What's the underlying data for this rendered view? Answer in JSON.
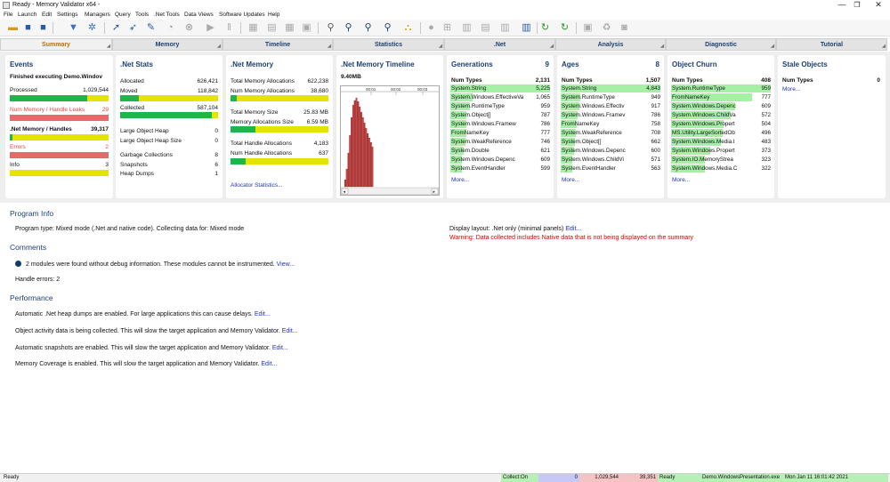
{
  "window": {
    "title": "Ready - Memory Validator x64 -",
    "minimize": "—",
    "maximize": "❐",
    "close": "✕"
  },
  "menu": [
    "File",
    "Launch",
    "Edit",
    "Settings",
    "Managers",
    "Query",
    "Tools",
    ".Net Tools",
    "Data Views",
    "Software Updates",
    "Help"
  ],
  "tabs": [
    "Summary",
    "Memory",
    "Timeline",
    "Statistics",
    ".Net",
    "Analysis",
    "Diagnostic",
    "Tutorial"
  ],
  "events": {
    "title": "Events",
    "status": "Finished executing Demo.Windov",
    "processed_label": "Processed",
    "processed_value": "1,029,544",
    "processed_fraction": 0.78,
    "leaks_label": "Num Memory / Handle Leaks",
    "leaks_value": "29",
    "handles_label": ".Net Memory / Handles",
    "handles_value": "39,317",
    "handles_fraction": 0.03,
    "errors_label": "Errors",
    "errors_value": "2",
    "info_label": "Info",
    "info_value": "3"
  },
  "netstats": {
    "title": ".Net Stats",
    "allocated_label": "Allocated",
    "allocated_value": "626,421",
    "moved_label": "Moved",
    "moved_value": "118,842",
    "moved_fraction": 0.19,
    "collected_label": "Collected",
    "collected_value": "587,104",
    "collected_fraction": 0.94,
    "loh_label": "Large Object Heap",
    "loh_value": "0",
    "lohs_label": "Large Object Heap Size",
    "lohs_value": "0",
    "gc_label": "Garbage Collections",
    "gc_value": "8",
    "snap_label": "Snapshots",
    "snap_value": "6",
    "dumps_label": "Heap Dumps",
    "dumps_value": "1"
  },
  "netmemory": {
    "title": ".Net Memory",
    "total_alloc_label": "Total Memory Allocations",
    "total_alloc_value": "622,238",
    "num_alloc_label": "Num Memory Allocations",
    "num_alloc_value": "38,680",
    "num_alloc_fraction": 0.06,
    "total_size_label": "Total Memory Size",
    "total_size_value": "25.83 MB",
    "alloc_size_label": "Memory Allocations Size",
    "alloc_size_value": "6.59 MB",
    "alloc_size_fraction": 0.25,
    "total_handle_label": "Total Handle Allocations",
    "total_handle_value": "4,183",
    "num_handle_label": "Num Handle Allocations",
    "num_handle_value": "637",
    "num_handle_fraction": 0.15,
    "link": "Allocator Statistics..."
  },
  "timeline": {
    "title": ".Net Memory Timeline",
    "peak": "9.40MB",
    "ticks": [
      "00:01",
      "00:02",
      "00:03"
    ]
  },
  "chart_data": {
    "type": "bar",
    "values": [
      8,
      20,
      38,
      58,
      78,
      92,
      97,
      100,
      96,
      90,
      84,
      78,
      72,
      66,
      60,
      55,
      50,
      45
    ],
    "ylim": [
      0,
      100
    ],
    "xlabel": "",
    "ylabel": ""
  },
  "generations": {
    "title": "Generations",
    "count": "9",
    "header_label": "Num Types",
    "header_value": "2,131",
    "rows": [
      {
        "name": "System.String",
        "value": "5,225",
        "frac": 1.0
      },
      {
        "name": "System.Windows.EffectiveVa",
        "value": "1,065",
        "frac": 0.22
      },
      {
        "name": "System.RuntimeType",
        "value": "959",
        "frac": 0.2
      },
      {
        "name": "System.Object[]",
        "value": "787",
        "frac": 0.16
      },
      {
        "name": "System.Windows.Framew",
        "value": "786",
        "frac": 0.16
      },
      {
        "name": "FromNameKey",
        "value": "777",
        "frac": 0.16
      },
      {
        "name": "System.WeakReference",
        "value": "746",
        "frac": 0.15
      },
      {
        "name": "System.Double",
        "value": "621",
        "frac": 0.13
      },
      {
        "name": "System.Windows.Depenc",
        "value": "609",
        "frac": 0.12
      },
      {
        "name": "System.EventHandler",
        "value": "599",
        "frac": 0.12
      }
    ],
    "more": "More..."
  },
  "ages": {
    "title": "Ages",
    "count": "8",
    "header_label": "Num Types",
    "header_value": "1,507",
    "rows": [
      {
        "name": "System.String",
        "value": "4,843",
        "frac": 1.0
      },
      {
        "name": "System.RuntimeType",
        "value": "949",
        "frac": 0.2
      },
      {
        "name": "System.Windows.Effectiv",
        "value": "917",
        "frac": 0.19
      },
      {
        "name": "System.Windows.Framev",
        "value": "786",
        "frac": 0.17
      },
      {
        "name": "FromNameKey",
        "value": "758",
        "frac": 0.16
      },
      {
        "name": "System.WeakReference",
        "value": "708",
        "frac": 0.15
      },
      {
        "name": "System.Object[]",
        "value": "662",
        "frac": 0.14
      },
      {
        "name": "System.Windows.Depenc",
        "value": "600",
        "frac": 0.13
      },
      {
        "name": "System.Windows.ChildVi",
        "value": "571",
        "frac": 0.12
      },
      {
        "name": "System.EventHandler",
        "value": "563",
        "frac": 0.12
      }
    ],
    "more": "More..."
  },
  "churn": {
    "title": "Object Churn",
    "header_label": "Num Types",
    "header_value": "408",
    "rows": [
      {
        "name": "System.RuntimeType",
        "value": "959",
        "frac": 1.0
      },
      {
        "name": "FromNameKey",
        "value": "777",
        "frac": 0.81
      },
      {
        "name": "System.Windows.Depenc",
        "value": "609",
        "frac": 0.64
      },
      {
        "name": "System.Windows.ChildVa",
        "value": "572",
        "frac": 0.6
      },
      {
        "name": "System.Windows.Propert",
        "value": "504",
        "frac": 0.53
      },
      {
        "name": "MS.Utility.LargeSortedOb",
        "value": "496",
        "frac": 0.52
      },
      {
        "name": "System.Windows.Media.I",
        "value": "483",
        "frac": 0.5
      },
      {
        "name": "System.Windows.Propert",
        "value": "373",
        "frac": 0.39
      },
      {
        "name": "System.IO.MemoryStrea",
        "value": "323",
        "frac": 0.34
      },
      {
        "name": "System.Windows.Media.C",
        "value": "322",
        "frac": 0.34
      }
    ],
    "more": "More..."
  },
  "stale": {
    "title": "Stale Objects",
    "header_label": "Num Types",
    "header_value": "0",
    "more": "More..."
  },
  "info": {
    "program_title": "Program Info",
    "program_type": "Program type: Mixed mode (.Net and native code). Collecting data for: Mixed mode",
    "display_layout": "Display layout: .Net only (minimal panels)",
    "edit": "Edit...",
    "warning": "Warning: Data collected includes Native data that is not being displayed on the summary",
    "comments_title": "Comments",
    "modules": "2 modules were found without debug information. These modules cannot be instrumented.",
    "view": "View...",
    "handle_errors": "Handle errors: 2",
    "perf_title": "Performance",
    "perf1": "Automatic .Net heap dumps are enabled. For large applications this can cause delays.",
    "perf2": "Object activity data is being collected. This will slow the target application and Memory Validator.",
    "perf3": "Automatic snapshots are enabled. This will slow the target application and Memory Validator.",
    "perf4": "Memory Coverage is enabled. This will slow the target application and Memory Validator."
  },
  "status": {
    "left": "Ready",
    "collect": "Collect:On",
    "v1": "0",
    "v2": "1,029,544",
    "v3": "39,351",
    "ready": "Ready",
    "proc": "Demo.WindowsPresentation.exe",
    "time": "Mon Jan 11 16:01:42 2021"
  },
  "colors": {
    "green": "#1fb54a",
    "yellow": "#e4e400",
    "red": "#e66a6a",
    "highlight": "#a6f0a6",
    "title": "#1c3f72",
    "active_tab": "#c46a00"
  }
}
